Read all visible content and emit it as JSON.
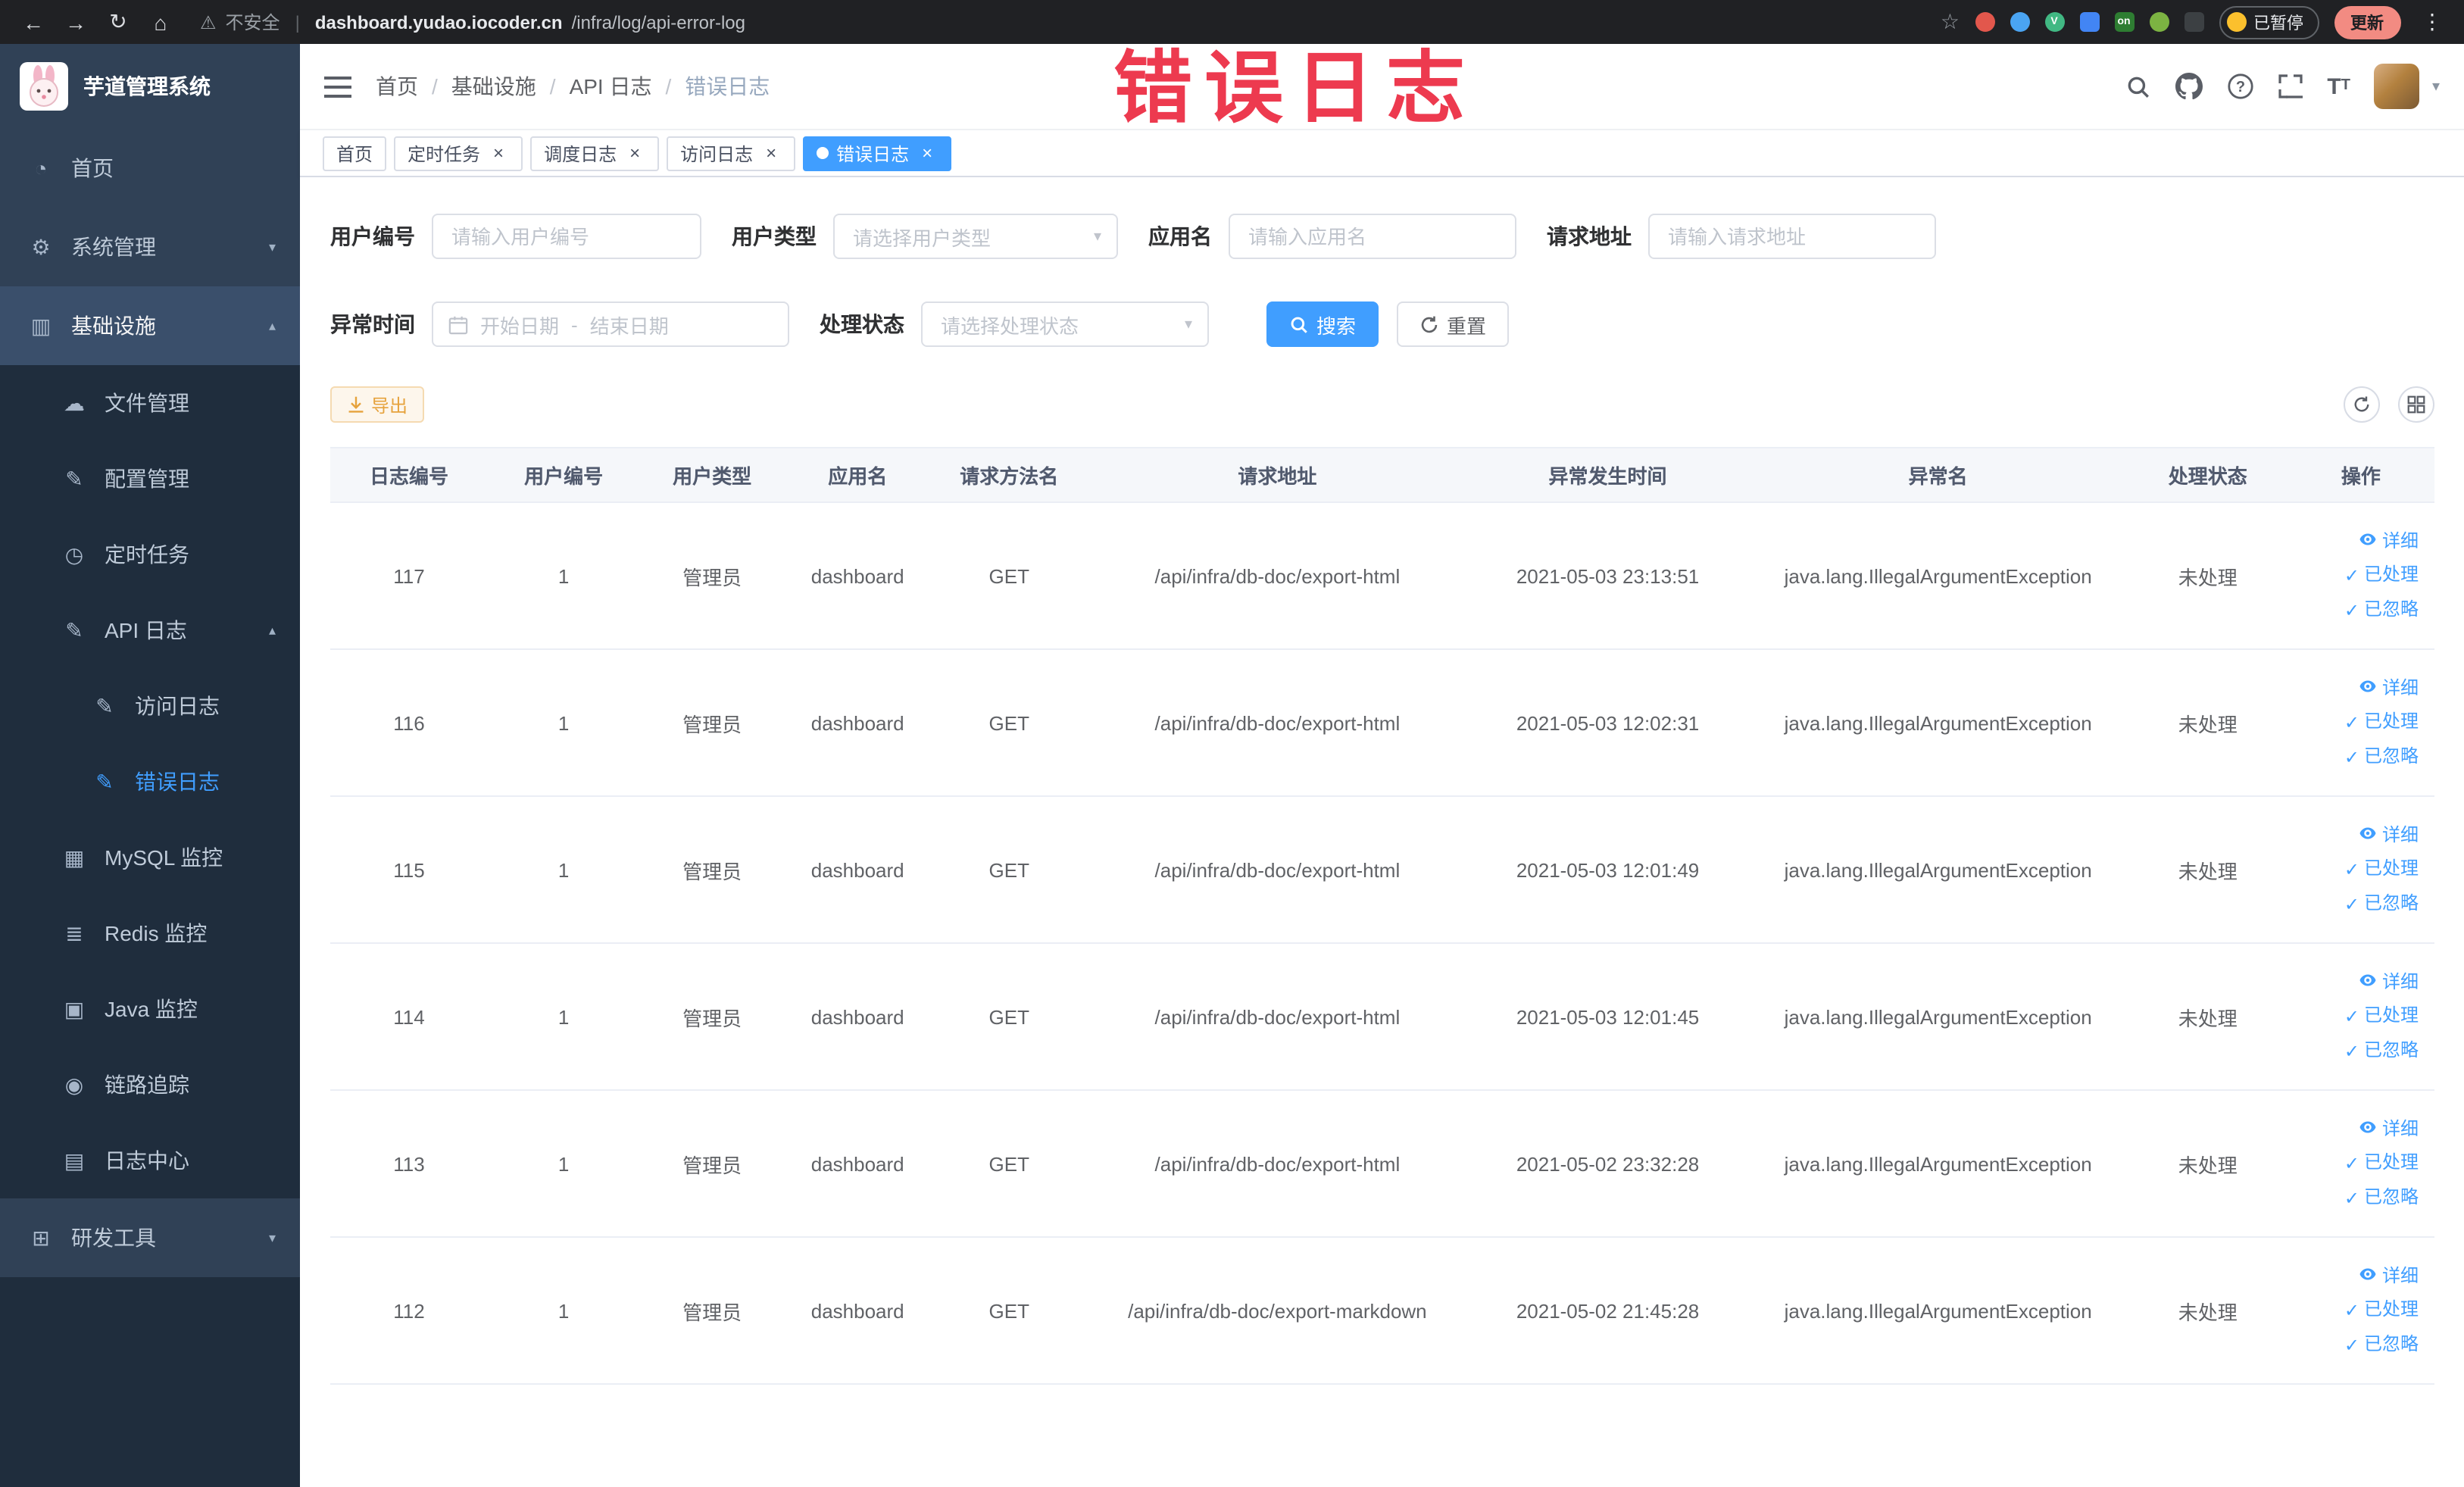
{
  "browser": {
    "security_label": "不安全",
    "url_domain": "dashboard.yudao.iocoder.cn",
    "url_path": "/infra/log/api-error-log",
    "paused_badge": "已暂停",
    "update_button": "更新",
    "extension_icons": [
      {
        "name": "adblock-icon",
        "color": "#e2574c",
        "shape": "circle"
      },
      {
        "name": "water-drop-icon",
        "color": "#4aa4f2",
        "shape": "circle"
      },
      {
        "name": "vue-devtools-icon",
        "color": "#41b883",
        "shape": "circle",
        "text": "V"
      },
      {
        "name": "tiles-icon",
        "color": "#4285f4",
        "shape": "square"
      },
      {
        "name": "on-switch-icon",
        "color": "#2e7d32",
        "shape": "square",
        "text": "on"
      },
      {
        "name": "sprout-icon",
        "color": "#7cb342",
        "shape": "circle"
      },
      {
        "name": "pickaxe-icon",
        "color": "#3c4043",
        "shape": "square"
      }
    ]
  },
  "annotation": {
    "text": "错误日志",
    "color": "#ed3a4f"
  },
  "colors": {
    "primary": "#409EFF",
    "warning": "#e6a23c",
    "sidebar_bg": "#304156",
    "sidebar_sub_bg": "#1f2d3d"
  },
  "sidebar": {
    "logo_title": "芋道管理系统",
    "items": [
      {
        "id": "home",
        "label": "首页",
        "icon": "dashboard-icon",
        "level": 1
      },
      {
        "id": "system",
        "label": "系统管理",
        "icon": "gear-icon",
        "level": 1,
        "chevron": "down"
      },
      {
        "id": "infra",
        "label": "基础设施",
        "icon": "infra-icon",
        "level": 1,
        "chevron": "up",
        "highlight": true
      },
      {
        "id": "file",
        "label": "文件管理",
        "icon": "cloud-icon",
        "level": 2
      },
      {
        "id": "config",
        "label": "配置管理",
        "icon": "edit-icon",
        "level": 2
      },
      {
        "id": "job",
        "label": "定时任务",
        "icon": "clock-icon",
        "level": 2
      },
      {
        "id": "api-log",
        "label": "API 日志",
        "icon": "edit-icon",
        "level": 2,
        "chevron": "up"
      },
      {
        "id": "access-log",
        "label": "访问日志",
        "icon": "edit-icon",
        "level": 3
      },
      {
        "id": "error-log",
        "label": "错误日志",
        "icon": "edit-icon",
        "level": 3,
        "active": true
      },
      {
        "id": "mysql",
        "label": "MySQL 监控",
        "icon": "grid-icon",
        "level": 2
      },
      {
        "id": "redis",
        "label": "Redis 监控",
        "icon": "layers-icon",
        "level": 2
      },
      {
        "id": "java",
        "label": "Java 监控",
        "icon": "monitor-icon",
        "level": 2
      },
      {
        "id": "tracer",
        "label": "链路追踪",
        "icon": "eye-icon",
        "level": 2
      },
      {
        "id": "log-center",
        "label": "日志中心",
        "icon": "document-icon",
        "level": 2
      },
      {
        "id": "dev-tools",
        "label": "研发工具",
        "icon": "toolbox-icon",
        "level": 1,
        "chevron": "down"
      }
    ]
  },
  "header": {
    "breadcrumb": [
      "首页",
      "基础设施",
      "API 日志",
      "错误日志"
    ]
  },
  "tabs": [
    {
      "label": "首页",
      "closable": false,
      "active": false
    },
    {
      "label": "定时任务",
      "closable": true,
      "active": false
    },
    {
      "label": "调度日志",
      "closable": true,
      "active": false
    },
    {
      "label": "访问日志",
      "closable": true,
      "active": false
    },
    {
      "label": "错误日志",
      "closable": true,
      "active": true
    }
  ],
  "filters": {
    "user_id": {
      "label": "用户编号",
      "placeholder": "请输入用户编号"
    },
    "user_type": {
      "label": "用户类型",
      "placeholder": "请选择用户类型"
    },
    "app_name": {
      "label": "应用名",
      "placeholder": "请输入应用名"
    },
    "request_url": {
      "label": "请求地址",
      "placeholder": "请输入请求地址"
    },
    "exception_time": {
      "label": "异常时间",
      "start_placeholder": "开始日期",
      "separator": "-",
      "end_placeholder": "结束日期"
    },
    "process_status": {
      "label": "处理状态",
      "placeholder": "请选择处理状态"
    },
    "search_button": "搜索",
    "reset_button": "重置"
  },
  "toolbar": {
    "export_button": "导出"
  },
  "table": {
    "headers": [
      "日志编号",
      "用户编号",
      "用户类型",
      "应用名",
      "请求方法名",
      "请求地址",
      "异常发生时间",
      "异常名",
      "处理状态",
      "操作"
    ],
    "actions": [
      "详细",
      "已处理",
      "已忽略"
    ],
    "rows": [
      {
        "id": "117",
        "user_id": "1",
        "user_type": "管理员",
        "app": "dashboard",
        "method": "GET",
        "url": "/api/infra/db-doc/export-html",
        "time": "2021-05-03 23:13:51",
        "exception": "java.lang.IllegalArgumentException",
        "status": "未处理"
      },
      {
        "id": "116",
        "user_id": "1",
        "user_type": "管理员",
        "app": "dashboard",
        "method": "GET",
        "url": "/api/infra/db-doc/export-html",
        "time": "2021-05-03 12:02:31",
        "exception": "java.lang.IllegalArgumentException",
        "status": "未处理"
      },
      {
        "id": "115",
        "user_id": "1",
        "user_type": "管理员",
        "app": "dashboard",
        "method": "GET",
        "url": "/api/infra/db-doc/export-html",
        "time": "2021-05-03 12:01:49",
        "exception": "java.lang.IllegalArgumentException",
        "status": "未处理"
      },
      {
        "id": "114",
        "user_id": "1",
        "user_type": "管理员",
        "app": "dashboard",
        "method": "GET",
        "url": "/api/infra/db-doc/export-html",
        "time": "2021-05-03 12:01:45",
        "exception": "java.lang.IllegalArgumentException",
        "status": "未处理"
      },
      {
        "id": "113",
        "user_id": "1",
        "user_type": "管理员",
        "app": "dashboard",
        "method": "GET",
        "url": "/api/infra/db-doc/export-html",
        "time": "2021-05-02 23:32:28",
        "exception": "java.lang.IllegalArgumentException",
        "status": "未处理"
      },
      {
        "id": "112",
        "user_id": "1",
        "user_type": "管理员",
        "app": "dashboard",
        "method": "GET",
        "url": "/api/infra/db-doc/export-markdown",
        "time": "2021-05-02 21:45:28",
        "exception": "java.lang.IllegalArgumentException",
        "status": "未处理"
      }
    ]
  }
}
